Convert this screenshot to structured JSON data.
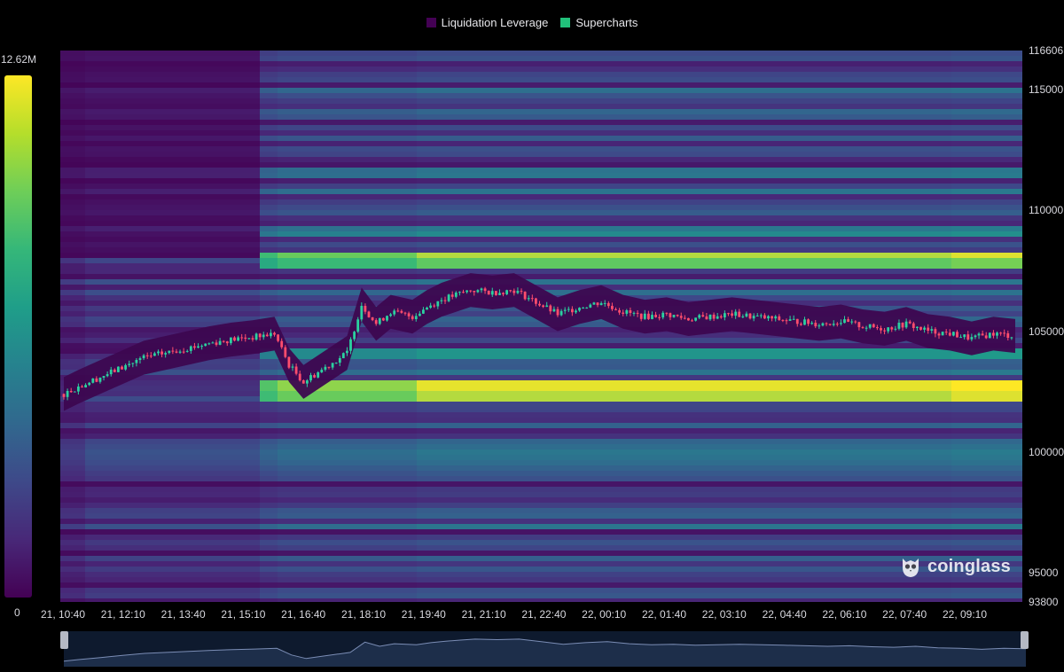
{
  "legend": {
    "items": [
      {
        "label": "Liquidation Leverage",
        "color": "#440154"
      },
      {
        "label": "Supercharts",
        "color": "#21c07a"
      }
    ]
  },
  "colorbar": {
    "max_label": "12.62M",
    "min_label": "0",
    "colors": [
      "#fde725",
      "#b5de2b",
      "#6ece58",
      "#35b779",
      "#1f9e89",
      "#26828e",
      "#31688e",
      "#3e4989",
      "#482878",
      "#440154"
    ]
  },
  "watermark": {
    "text": "coinglass",
    "icon": "owl-mascot-icon"
  },
  "chart_data": {
    "type": "heatmap",
    "overlay": "candlestick",
    "title": "",
    "x_ticks": [
      "21, 10:40",
      "21, 12:10",
      "21, 13:40",
      "21, 15:10",
      "21, 16:40",
      "21, 18:10",
      "21, 19:40",
      "21, 21:10",
      "21, 22:40",
      "22, 00:10",
      "22, 01:40",
      "22, 03:10",
      "22, 04:40",
      "22, 06:10",
      "22, 07:40",
      "22, 09:10"
    ],
    "y_ticks": [
      "116606",
      "115000",
      "110000",
      "105000",
      "100000",
      "95000",
      "93800"
    ],
    "y_tick_values": [
      116606,
      115000,
      110000,
      105000,
      100000,
      95000,
      93800
    ],
    "ylim": [
      93800,
      116606
    ],
    "colorscale_range": [
      0,
      12620000
    ],
    "price_path": [
      {
        "t": 0,
        "p": 102400
      },
      {
        "t": 4,
        "p": 102700
      },
      {
        "t": 10,
        "p": 103100
      },
      {
        "t": 16,
        "p": 103500
      },
      {
        "t": 22,
        "p": 103900
      },
      {
        "t": 28,
        "p": 104100
      },
      {
        "t": 34,
        "p": 104300
      },
      {
        "t": 40,
        "p": 104500
      },
      {
        "t": 46,
        "p": 104650
      },
      {
        "t": 52,
        "p": 104750
      },
      {
        "t": 58,
        "p": 104900
      },
      {
        "t": 62,
        "p": 103600
      },
      {
        "t": 66,
        "p": 102900
      },
      {
        "t": 72,
        "p": 103500
      },
      {
        "t": 78,
        "p": 104100
      },
      {
        "t": 82,
        "p": 106100
      },
      {
        "t": 86,
        "p": 105300
      },
      {
        "t": 90,
        "p": 105800
      },
      {
        "t": 96,
        "p": 105600
      },
      {
        "t": 100,
        "p": 106000
      },
      {
        "t": 104,
        "p": 106300
      },
      {
        "t": 108,
        "p": 106500
      },
      {
        "t": 112,
        "p": 106700
      },
      {
        "t": 118,
        "p": 106600
      },
      {
        "t": 124,
        "p": 106700
      },
      {
        "t": 130,
        "p": 106200
      },
      {
        "t": 136,
        "p": 105700
      },
      {
        "t": 142,
        "p": 106000
      },
      {
        "t": 148,
        "p": 106200
      },
      {
        "t": 154,
        "p": 105800
      },
      {
        "t": 160,
        "p": 105600
      },
      {
        "t": 166,
        "p": 105700
      },
      {
        "t": 172,
        "p": 105500
      },
      {
        "t": 178,
        "p": 105600
      },
      {
        "t": 184,
        "p": 105700
      },
      {
        "t": 190,
        "p": 105600
      },
      {
        "t": 196,
        "p": 105500
      },
      {
        "t": 202,
        "p": 105400
      },
      {
        "t": 208,
        "p": 105300
      },
      {
        "t": 214,
        "p": 105400
      },
      {
        "t": 220,
        "p": 105200
      },
      {
        "t": 226,
        "p": 105100
      },
      {
        "t": 232,
        "p": 105300
      },
      {
        "t": 238,
        "p": 105000
      },
      {
        "t": 244,
        "p": 104900
      },
      {
        "t": 250,
        "p": 104700
      },
      {
        "t": 256,
        "p": 104900
      },
      {
        "t": 262,
        "p": 104800
      }
    ]
  }
}
